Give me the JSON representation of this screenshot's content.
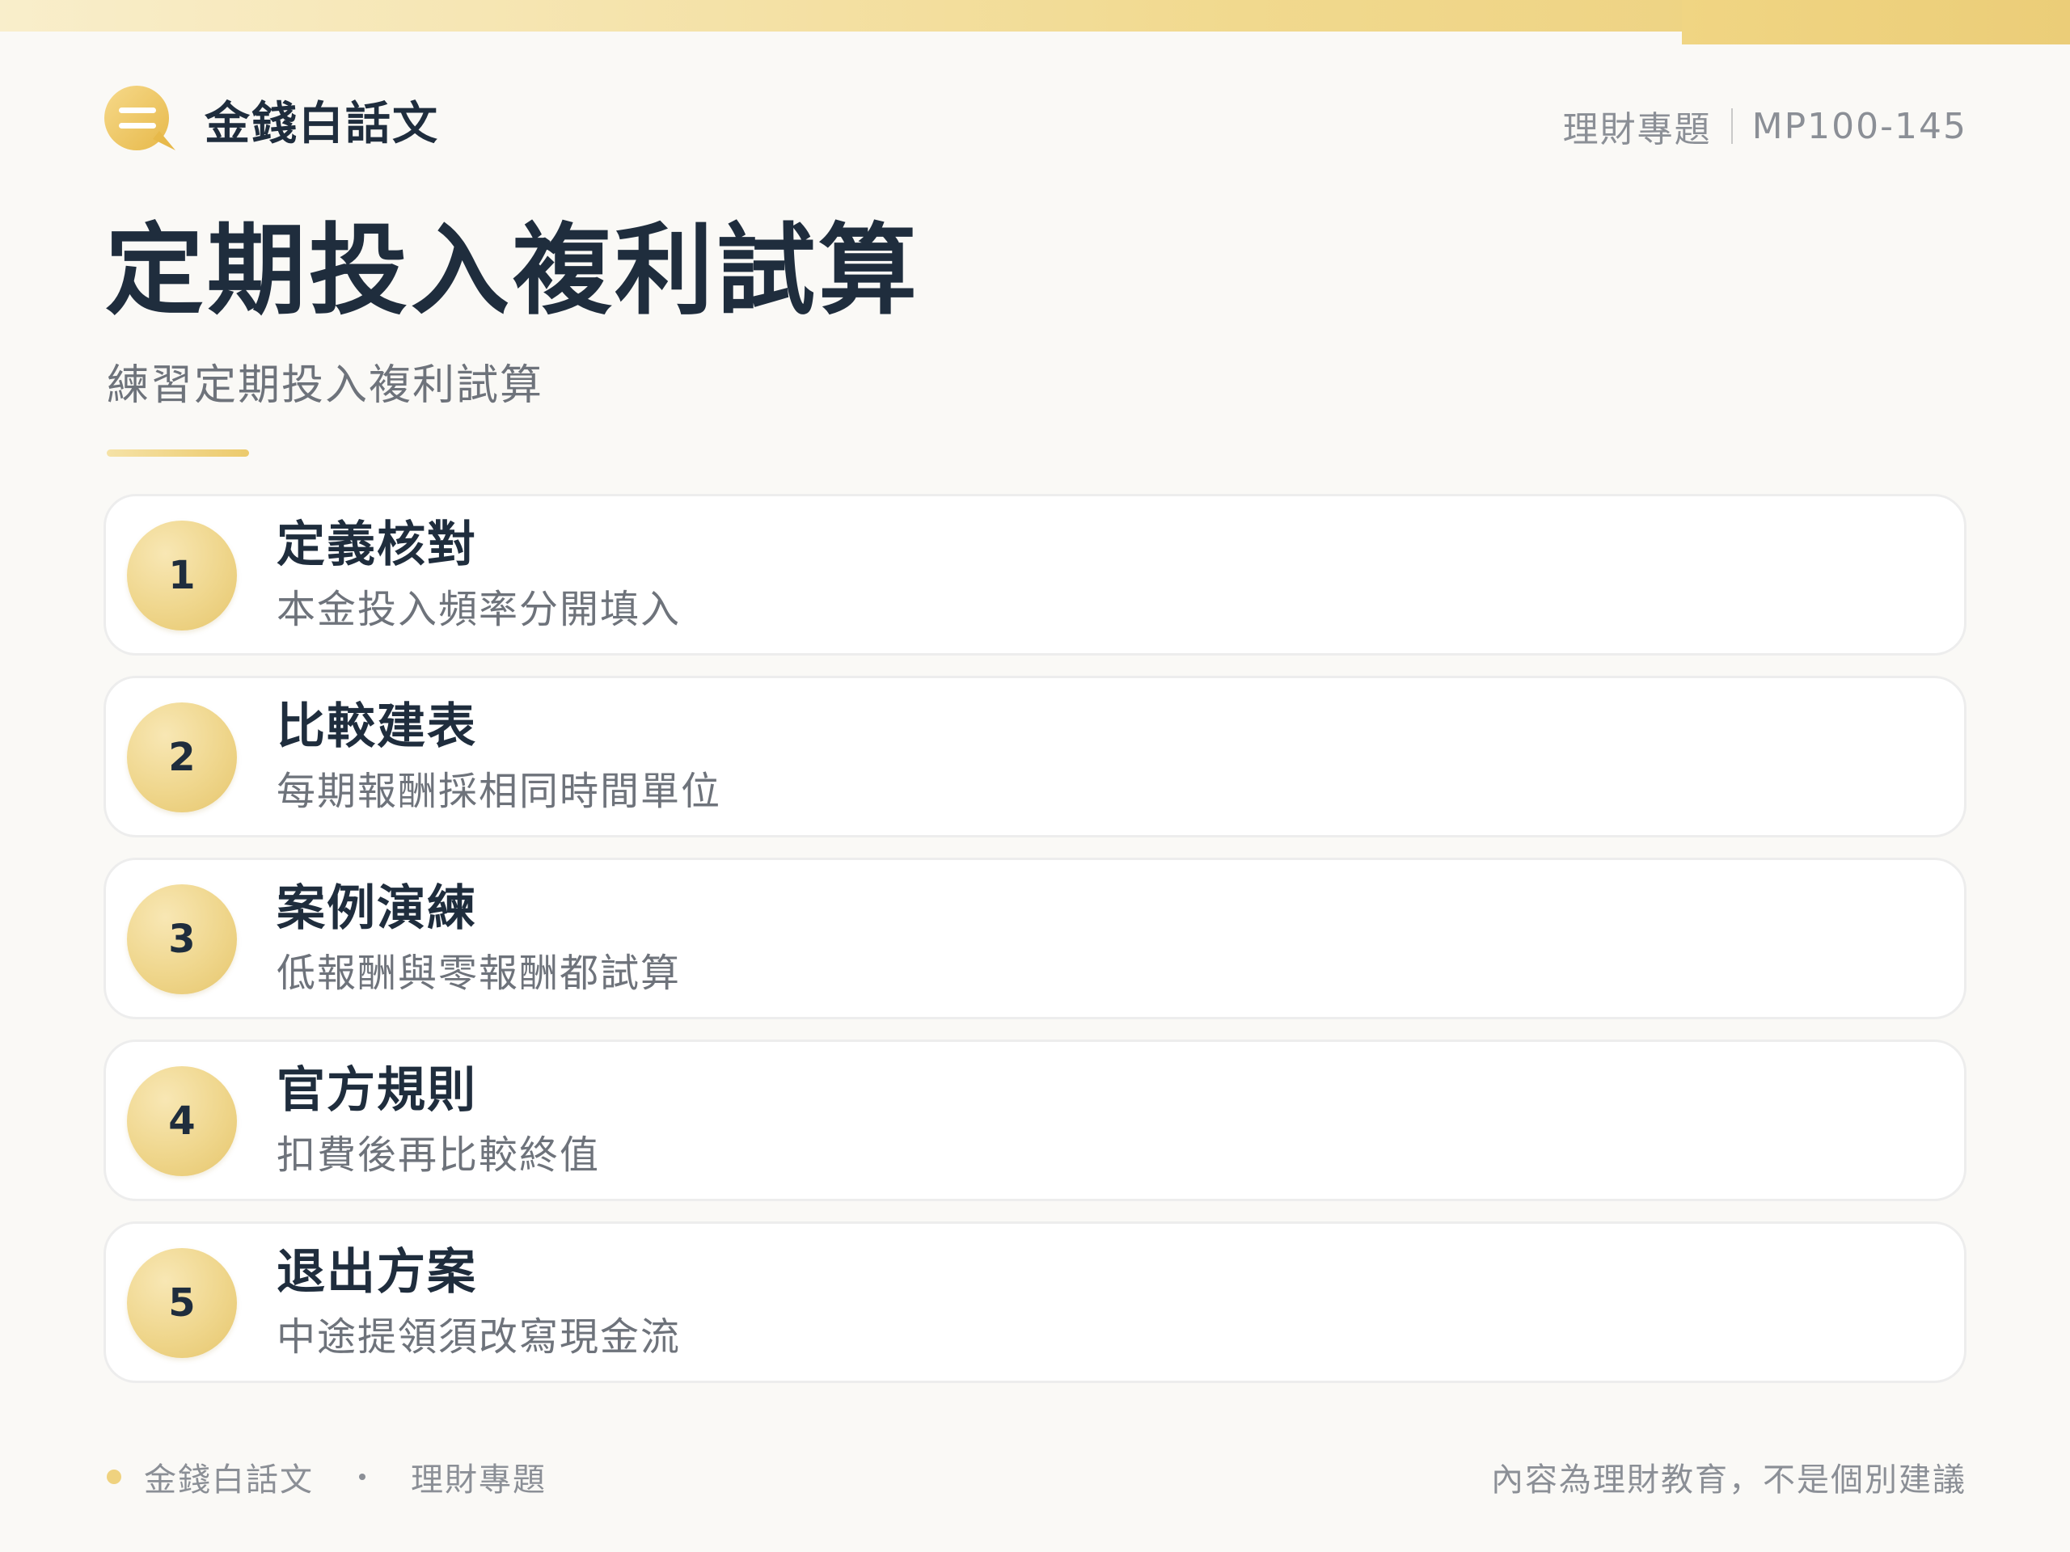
{
  "header": {
    "brand_name": "金錢白話文",
    "brand_icon": "speech-bubble-icon",
    "category": "理財專題",
    "code": "MP100-145"
  },
  "page": {
    "title": "定期投入複利試算",
    "subtitle": "練習定期投入複利試算"
  },
  "steps": [
    {
      "num": "1",
      "title": "定義核對",
      "desc": "本金投入頻率分開填入"
    },
    {
      "num": "2",
      "title": "比較建表",
      "desc": "每期報酬採相同時間單位"
    },
    {
      "num": "3",
      "title": "案例演練",
      "desc": "低報酬與零報酬都試算"
    },
    {
      "num": "4",
      "title": "官方規則",
      "desc": "扣費後再比較終值"
    },
    {
      "num": "5",
      "title": "退出方案",
      "desc": "中途提領須改寫現金流"
    }
  ],
  "footer": {
    "brand": "金錢白話文",
    "category": "理財專題",
    "disclaimer": "內容為理財教育，不是個別建議"
  },
  "colors": {
    "accent_gold": "#ecca6c",
    "text_dark": "#1f2d3d",
    "text_muted": "#8b8f96"
  }
}
